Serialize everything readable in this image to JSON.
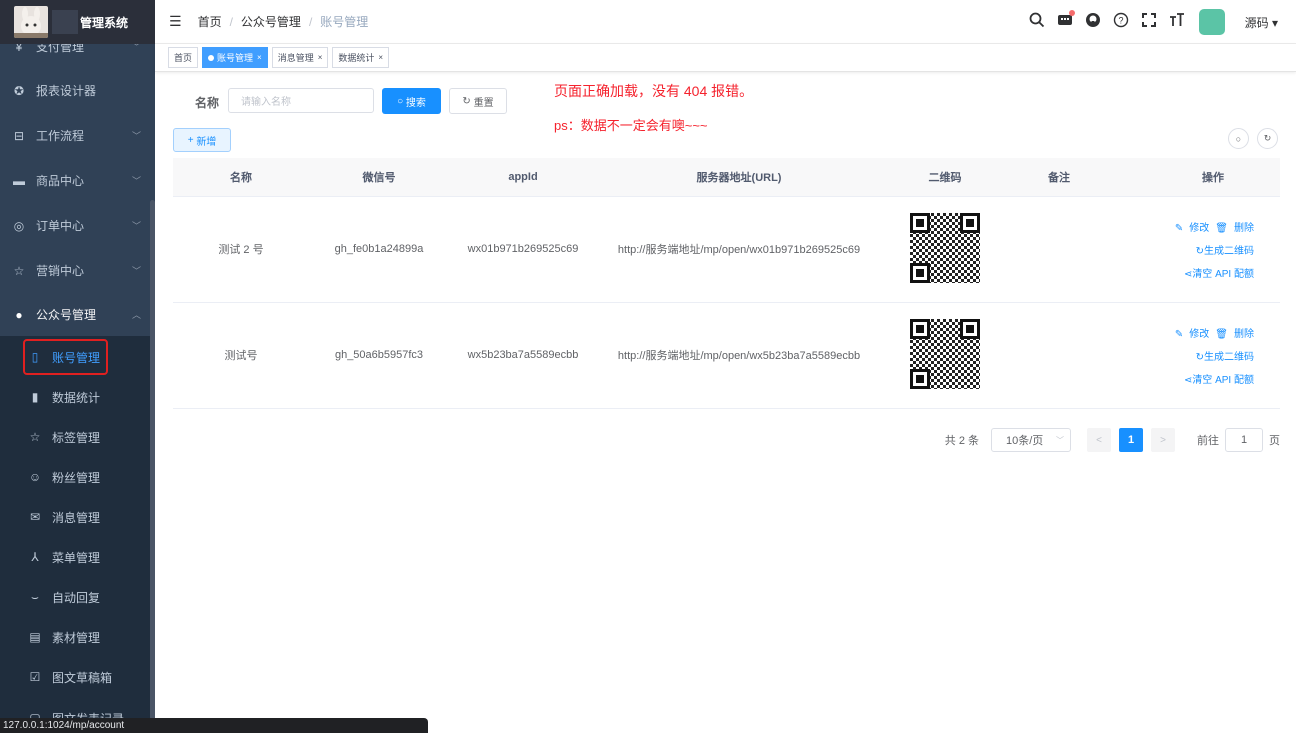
{
  "app": {
    "title": "管理系统"
  },
  "sidebar": {
    "items": [
      {
        "label": "支付管理",
        "icon": "payment-icon"
      },
      {
        "label": "报表设计器",
        "icon": "report-icon"
      },
      {
        "label": "工作流程",
        "icon": "workflow-icon"
      },
      {
        "label": "商品中心",
        "icon": "product-icon"
      },
      {
        "label": "订单中心",
        "icon": "order-icon"
      },
      {
        "label": "营销中心",
        "icon": "marketing-icon"
      },
      {
        "label": "公众号管理",
        "icon": "wechat-icon"
      }
    ],
    "sub_items": [
      {
        "label": "账号管理",
        "icon": "phone-icon"
      },
      {
        "label": "数据统计",
        "icon": "bar-chart-icon"
      },
      {
        "label": "标签管理",
        "icon": "star-icon"
      },
      {
        "label": "粉丝管理",
        "icon": "fans-icon"
      },
      {
        "label": "消息管理",
        "icon": "message-icon"
      },
      {
        "label": "菜单管理",
        "icon": "menu-icon"
      },
      {
        "label": "自动回复",
        "icon": "auto-reply-icon"
      },
      {
        "label": "素材管理",
        "icon": "material-icon"
      },
      {
        "label": "图文草稿箱",
        "icon": "draft-icon"
      },
      {
        "label": "图文发表记录",
        "icon": "publish-icon"
      }
    ]
  },
  "navbar": {
    "breadcrumb": [
      "首页",
      "公众号管理",
      "账号管理"
    ],
    "user": "源码"
  },
  "tags": [
    "首页",
    "账号管理",
    "消息管理",
    "数据统计"
  ],
  "search": {
    "label": "名称",
    "placeholder": "请输入名称",
    "search_btn": "搜索",
    "reset_btn": "重置",
    "add_btn": "新增"
  },
  "notes": {
    "line1": "页面正确加载，没有 404 报错。",
    "line2": "ps：数据不一定会有噢~~~"
  },
  "table": {
    "headers": [
      "名称",
      "微信号",
      "appId",
      "服务器地址(URL)",
      "二维码",
      "备注",
      "操作"
    ],
    "rows": [
      {
        "name": "测试 2 号",
        "wechat": "gh_fe0b1a24899a",
        "appid": "wx01b971b269525c69",
        "url": "http://服务端地址/mp/open/wx01b971b269525c69",
        "remark": ""
      },
      {
        "name": "测试号",
        "wechat": "gh_50a6b5957fc3",
        "appid": "wx5b23ba7a5589ecbb",
        "url": "http://服务端地址/mp/open/wx5b23ba7a5589ecbb",
        "remark": ""
      }
    ],
    "ops": {
      "edit": "修改",
      "delete": "删除",
      "qrcode": "生成二维码",
      "clear": "清空 API 配额"
    }
  },
  "pagination": {
    "total": "共 2 条",
    "page_size": "10条/页",
    "current": "1",
    "goto_label": "前往",
    "goto_value": "1",
    "page_unit": "页"
  },
  "statusbar": {
    "url": "127.0.0.1:1024/mp/account"
  },
  "colors": {
    "sidebar": "#304156",
    "accent": "#1890ff",
    "note": "#f5222d"
  }
}
